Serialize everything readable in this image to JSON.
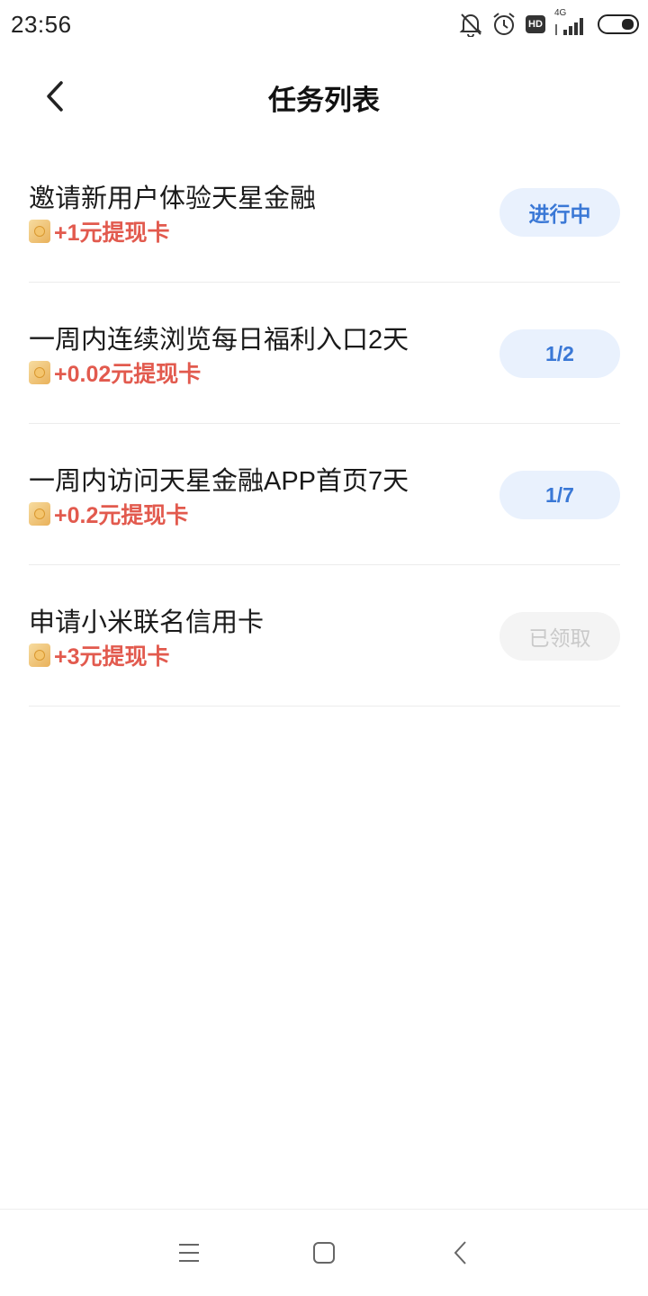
{
  "status_bar": {
    "time": "23:56",
    "hd_label": "HD",
    "network_label": "4G"
  },
  "header": {
    "title": "任务列表",
    "back_icon": "chevron-left-icon"
  },
  "tasks": [
    {
      "title": "邀请新用户体验天星金融",
      "reward": "+1元提现卡",
      "button": "进行中",
      "state": "in-progress"
    },
    {
      "title": "一周内连续浏览每日福利入口2天",
      "reward": "+0.02元提现卡",
      "button": "1/2",
      "state": "progress"
    },
    {
      "title": "一周内访问天星金融APP首页7天",
      "reward": "+0.2元提现卡",
      "button": "1/7",
      "state": "progress"
    },
    {
      "title": "申请小米联名信用卡",
      "reward": "+3元提现卡",
      "button": "已领取",
      "state": "claimed"
    }
  ],
  "nav_bar": {
    "menu_icon": "menu-icon",
    "home_icon": "home-square-icon",
    "back_icon": "back-triangle-icon"
  },
  "colors": {
    "accent": "#3a78d6",
    "button_bg": "#e9f1fd",
    "reward": "#e25a4e",
    "disabled": "#c9c9c9"
  }
}
